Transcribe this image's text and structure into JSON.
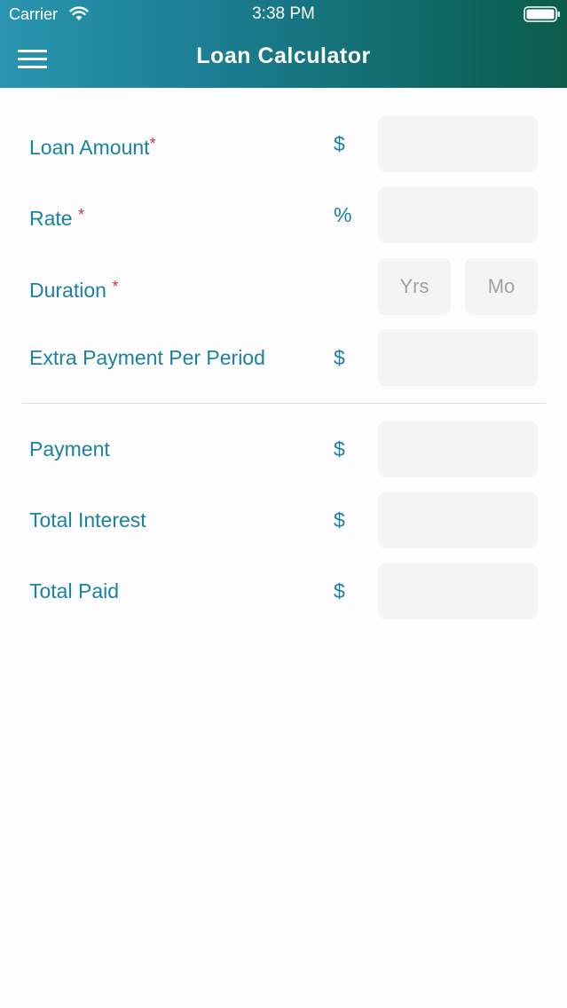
{
  "status_bar": {
    "carrier": "Carrier",
    "time": "3:38 PM",
    "wifi_icon": "wifi-icon",
    "battery_icon": "battery-icon"
  },
  "nav": {
    "title": "Loan Calculator",
    "menu_icon": "hamburger-menu-icon"
  },
  "colors": {
    "header_gradient_start": "#2a95b0",
    "header_gradient_end": "#0b5c4c",
    "label": "#1a82a3",
    "required": "#d9312b",
    "field_background": "#f4f3f6"
  },
  "inputs": {
    "loan_amount": {
      "label": "Loan Amount",
      "required_mark": "*",
      "unit": "$",
      "value": ""
    },
    "rate": {
      "label": "Rate",
      "required_mark": "*",
      "unit": "%",
      "value": ""
    },
    "duration": {
      "label": "Duration",
      "required_mark": "*",
      "years_placeholder": "Yrs",
      "months_placeholder": "Mo"
    },
    "extra_payment": {
      "label": "Extra Payment Per Period",
      "unit": "$",
      "value": ""
    }
  },
  "results": {
    "payment": {
      "label": "Payment",
      "unit": "$",
      "value": ""
    },
    "total_interest": {
      "label": "Total Interest",
      "unit": "$",
      "value": ""
    },
    "total_paid": {
      "label": "Total Paid",
      "unit": "$",
      "value": ""
    }
  }
}
